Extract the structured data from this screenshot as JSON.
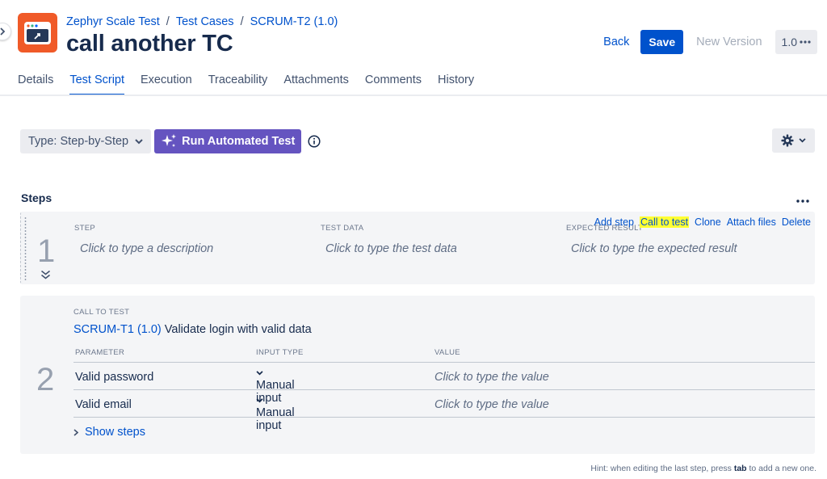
{
  "breadcrumb": {
    "project": "Zephyr Scale Test",
    "section": "Test Cases",
    "item": "SCRUM-T2 (1.0)"
  },
  "page_title": "call another TC",
  "header_actions": {
    "back": "Back",
    "save": "Save",
    "new_version": "New Version",
    "version": "1.0"
  },
  "tabs": [
    "Details",
    "Test Script",
    "Execution",
    "Traceability",
    "Attachments",
    "Comments",
    "History"
  ],
  "toolbar": {
    "type_select": "Type: Step-by-Step",
    "run_automated": "Run Automated Test"
  },
  "steps_title": "Steps",
  "step1": {
    "number": "1",
    "labels": {
      "step": "STEP",
      "test_data": "TEST DATA",
      "expected": "EXPECTED RESULT"
    },
    "placeholders": {
      "step": "Click to type a description",
      "test_data": "Click to type the test data",
      "expected": "Click to type the expected result"
    },
    "actions": [
      "Add step",
      "Call to test",
      "Clone",
      "Attach files",
      "Delete"
    ]
  },
  "step2": {
    "number": "2",
    "label": "CALL TO TEST",
    "ref": "SCRUM-T1 (1.0)",
    "ref_title": "Validate login with valid data",
    "headers": [
      "PARAMETER",
      "INPUT TYPE",
      "VALUE"
    ],
    "rows": [
      {
        "parameter": "Valid password",
        "input_type": "Manual input",
        "value": "Click to type the value"
      },
      {
        "parameter": "Valid email",
        "input_type": "Manual input",
        "value": "Click to type the value"
      }
    ],
    "show_steps": "Show steps"
  },
  "hint": {
    "prefix": "Hint: when editing the last step, press ",
    "key": "tab",
    "suffix": " to add a new one."
  },
  "colors": {
    "primary": "#0052cc",
    "logo": "#f05a28",
    "automated": "#6554c0",
    "highlight": "#ffff33"
  }
}
